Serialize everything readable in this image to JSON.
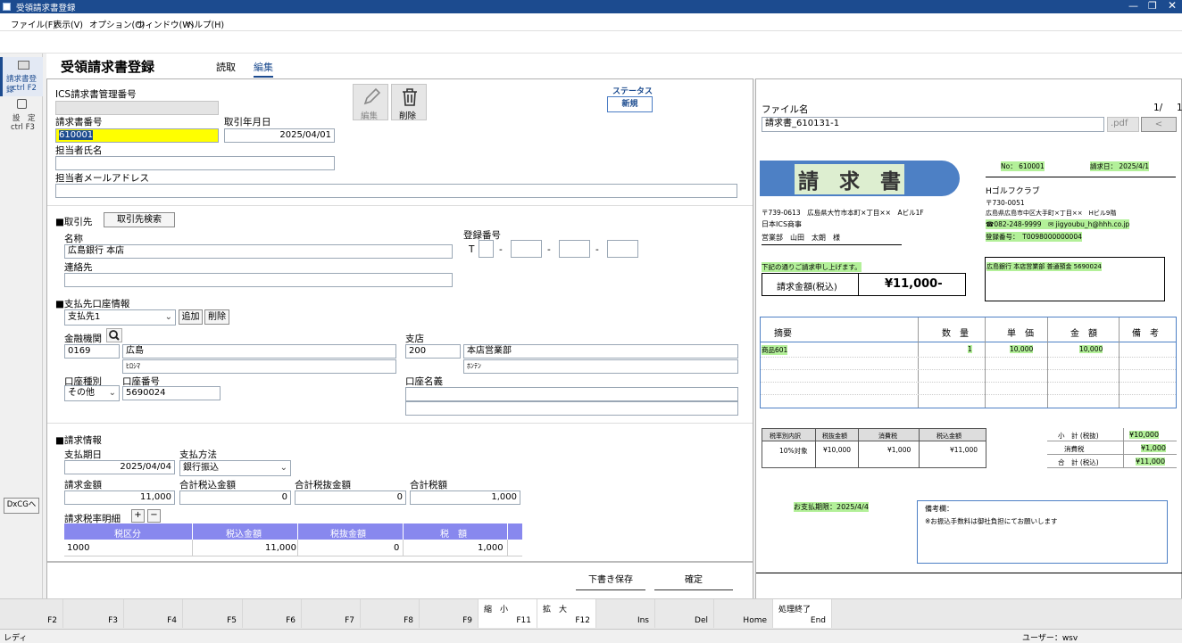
{
  "window": {
    "title": "受領請求書登録"
  },
  "menu": [
    "ファイル(F)",
    "表示(V)",
    "オプション(O)",
    "ウィンドウ(W)",
    "ヘルプ(H)"
  ],
  "nav": [
    {
      "label": "請求書登録",
      "key": "ctrl F2"
    },
    {
      "label": "設　定",
      "key": "ctrl F3"
    }
  ],
  "nav_bottom": "DxCGへ",
  "page": {
    "title": "受領請求書登録",
    "tabs": [
      "読取",
      "編集"
    ]
  },
  "tools": {
    "edit": "編集",
    "delete": "削除"
  },
  "status": {
    "label": "ステータス",
    "value": "新規"
  },
  "form": {
    "ics_no_label": "ICS請求書管理番号",
    "ics_no": "",
    "inv_no_label": "請求書番号",
    "inv_no": "610001",
    "date_label": "取引年月日",
    "date": "2025/04/01",
    "person_label": "担当者氏名",
    "person": "",
    "mail_label": "担当者メールアドレス",
    "mail": ""
  },
  "partner": {
    "section": "■取引先",
    "search_btn": "取引先検索",
    "name_label": "名称",
    "name": "広島銀行 本店",
    "contact_label": "連絡先",
    "contact": "",
    "reg_label": "登録番号",
    "reg_t": "T",
    "dash": "-"
  },
  "account": {
    "section": "■支払先口座情報",
    "select": "支払先1",
    "add": "追加",
    "del": "削除",
    "bank_label": "金融機関",
    "bank_code": "0169",
    "bank_name": "広島",
    "bank_kana": "ﾋﾛｼﾏ",
    "branch_label": "支店",
    "branch_code": "200",
    "branch_name": "本店営業部",
    "branch_kana": "ﾎﾝﾃﾝ",
    "type_label": "口座種別",
    "type": "その他",
    "acct_no_label": "口座番号",
    "acct_no": "5690024",
    "holder_label": "口座名義",
    "holder": ""
  },
  "billing": {
    "section": "■請求情報",
    "due_label": "支払期日",
    "due": "2025/04/04",
    "method_label": "支払方法",
    "method": "銀行振込",
    "amount_label": "請求金額",
    "amount": "11,000",
    "incl_label": "合計税込金額",
    "incl": "0",
    "excl_label": "合計税抜金額",
    "excl": "0",
    "tax_label": "合計税額",
    "tax": "1,000",
    "detail_label": "請求税率明細",
    "plus": "+",
    "minus": "−",
    "table": {
      "headers": [
        "税区分",
        "税込金額",
        "税抜金額",
        "税　額"
      ],
      "rows": [
        [
          "1000",
          "11,000",
          "0",
          "1,000"
        ]
      ]
    }
  },
  "buttons": {
    "draft": "下書き保存",
    "confirm": "確定"
  },
  "viewer": {
    "file_label": "ファイル名",
    "page": "1/",
    "page2": "1",
    "file_name": "請求書_610131-1",
    "ext": ".pdf",
    "prev": "<"
  },
  "doc": {
    "title": "請　求　書",
    "no": "No： 610001",
    "date": "請求日： 2025/4/1",
    "from_zip": "〒739-0613　広島県大竹市本町×丁目××　Aビル1F",
    "from_company": "日本ICS商事",
    "from_person": "営業部　山田　太朗　様",
    "to_company": "Hゴルフクラブ",
    "to_zip": "〒730-0051",
    "to_addr": "広島県広島市中区大手町×丁目××　Hビル9階",
    "to_tel": "☎082-248-9999　✉ jigyoubu_h@hhh.co.jp",
    "to_reg": "登録番号：　T0098000000004",
    "greeting": "下記の通りご請求申し上げます。",
    "amount_label": "請求金額(税込)",
    "amount": "¥11,000-",
    "bank": "広島銀行 本店営業部 普通預金 5690024",
    "item_headers": [
      "摘要",
      "数　量",
      "単　価",
      "金　額",
      "備　考"
    ],
    "items": [
      [
        "商品601",
        "1",
        "10,000",
        "10,000",
        ""
      ]
    ],
    "tax_headers": [
      "税率別内訳",
      "税抜金額",
      "消費税",
      "税込金額"
    ],
    "tax_row": [
      "10%対象",
      "¥10,000",
      "¥1,000",
      "¥11,000"
    ],
    "summary": [
      [
        "小　計 (税抜)",
        "¥10,000"
      ],
      [
        "消費税",
        "¥1,000"
      ],
      [
        "合　計 (税込)",
        "¥11,000"
      ]
    ],
    "due": "お支払期限：2025/4/4",
    "remarks_label": "備考欄：",
    "remarks": "※お振込手数料は御社負担にてお願いします"
  },
  "fkeys": [
    {
      "k": "F2",
      "t": ""
    },
    {
      "k": "F3",
      "t": ""
    },
    {
      "k": "F4",
      "t": ""
    },
    {
      "k": "F5",
      "t": ""
    },
    {
      "k": "F6",
      "t": ""
    },
    {
      "k": "F7",
      "t": ""
    },
    {
      "k": "F8",
      "t": ""
    },
    {
      "k": "F9",
      "t": ""
    },
    {
      "k": "F11",
      "t": "縮　小"
    },
    {
      "k": "F12",
      "t": "拡　大"
    },
    {
      "k": "Ins",
      "t": ""
    },
    {
      "k": "Del",
      "t": ""
    },
    {
      "k": "Home",
      "t": ""
    },
    {
      "k": "End",
      "t": "処理終了"
    }
  ],
  "statusbar": {
    "left": "レディ",
    "right": "ユーザー：wsv"
  }
}
